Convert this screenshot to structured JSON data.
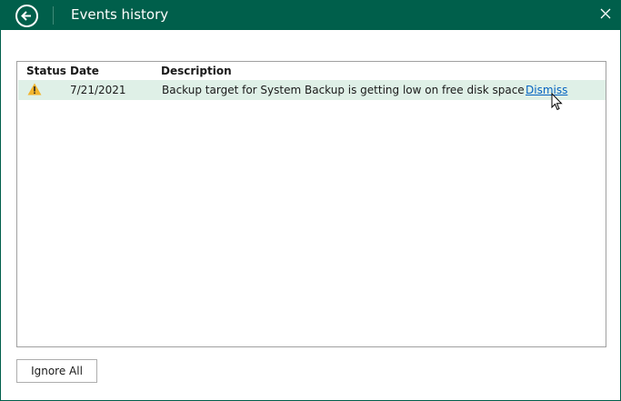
{
  "window": {
    "title": "Events history",
    "back_icon": "arrow-left-circle-icon",
    "close_icon": "close-icon",
    "accent": "#005f4b"
  },
  "table": {
    "columns": [
      "Status",
      "Date",
      "Description"
    ],
    "rows": [
      {
        "status": "warning",
        "date": "7/21/2021",
        "description": "Backup target for System Backup is getting low on free disk space",
        "action": "Dismiss"
      }
    ]
  },
  "footer": {
    "ignore_all": "Ignore All"
  }
}
